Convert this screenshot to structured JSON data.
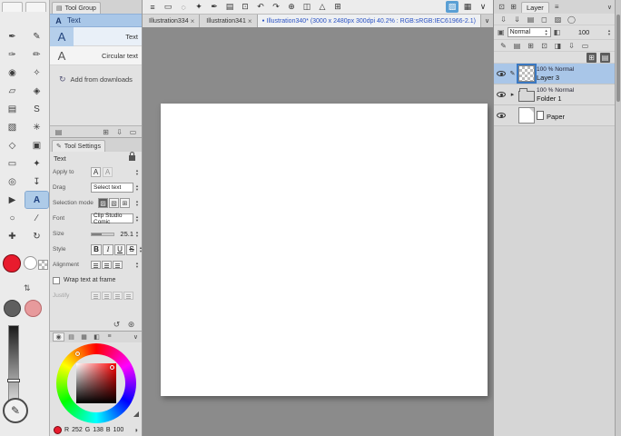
{
  "ui": {
    "spin_up": "▲",
    "spin_down": "▼",
    "chevron": "∨"
  },
  "colors": {
    "accent_blue": "#5a9fd4",
    "selection_blue": "#a9c6e8",
    "active_tab_text": "#2a52c4",
    "main_color_red": "#e81b2d"
  },
  "top_toolbar": {
    "icons": [
      {
        "glyph": "≡",
        "n": "main-menu-icon"
      },
      {
        "glyph": "▭",
        "n": "rect-select-icon"
      },
      {
        "glyph": "◌",
        "n": "lasso-select-icon"
      },
      {
        "glyph": "✦",
        "n": "auto-select-icon"
      },
      {
        "glyph": "✒",
        "n": "pen-box-icon"
      },
      {
        "glyph": "▤",
        "n": "fill-box-icon"
      },
      {
        "glyph": "⊡",
        "n": "canvas-settings-icon"
      },
      {
        "glyph": "↶",
        "n": "undo-icon"
      },
      {
        "glyph": "↷",
        "n": "redo-icon"
      },
      {
        "glyph": "⊕",
        "n": "add-icon"
      },
      {
        "glyph": "◫",
        "n": "panel-layout-icon"
      },
      {
        "glyph": "△",
        "n": "ruler-icon"
      },
      {
        "glyph": "⊞",
        "n": "grid-icon"
      }
    ],
    "right_icons": [
      {
        "glyph": "▨",
        "n": "workspace-active-icon",
        "blue": true
      },
      {
        "glyph": "▦",
        "n": "workspace-icon"
      },
      {
        "glyph": "∨",
        "n": "toolbar-overflow-chevron"
      }
    ]
  },
  "tab_bar": {
    "tabs": [
      {
        "label": "Illustration334",
        "close": "×"
      },
      {
        "label": "Illustration341",
        "close": "×"
      },
      {
        "label": "Illustration340* (3000 x 2480px 300dpi 40.2% : RGB:sRGB:IEC61966-2.1)",
        "dot": "●",
        "active": true
      }
    ]
  },
  "tool_strip": {
    "tools": [
      {
        "glyph": "✒",
        "n": "pen-tool"
      },
      {
        "glyph": "✎",
        "n": "pencil-tool"
      },
      {
        "glyph": "✑",
        "n": "brush-tool"
      },
      {
        "glyph": "✏",
        "n": "marker-tool"
      },
      {
        "glyph": "◉",
        "n": "airbrush-tool"
      },
      {
        "glyph": "✧",
        "n": "decoration-tool"
      },
      {
        "glyph": "▱",
        "n": "eraser-tool"
      },
      {
        "glyph": "◈",
        "n": "blend-tool"
      },
      {
        "glyph": "▤",
        "n": "fill-tool"
      },
      {
        "glyph": "S",
        "n": "s-brush-tool"
      },
      {
        "glyph": "▧",
        "n": "gradient-tool"
      },
      {
        "glyph": "✳",
        "n": "effect-tool"
      },
      {
        "glyph": "◇",
        "n": "figure-tool"
      },
      {
        "glyph": "▣",
        "n": "frame-border-tool"
      },
      {
        "glyph": "▭",
        "n": "selection-tool"
      },
      {
        "glyph": "✦",
        "n": "auto-select-tool"
      },
      {
        "glyph": "◎",
        "n": "zoom-tool"
      },
      {
        "glyph": "↧",
        "n": "eyedropper-tool"
      },
      {
        "glyph": "▶",
        "n": "operation-tool"
      },
      {
        "glyph": "A",
        "n": "text-tool",
        "selected": true
      },
      {
        "glyph": "○",
        "n": "balloon-tool"
      },
      {
        "glyph": "∕",
        "n": "line-tool"
      },
      {
        "glyph": "✚",
        "n": "move-tool"
      },
      {
        "glyph": "↻",
        "n": "rotate-tool"
      }
    ],
    "swap_icon": "⇅",
    "quick_glyph": "✎"
  },
  "tool_group": {
    "header": "Tool Group",
    "header_icon": "▤",
    "group_icon": "A",
    "group_label": "Text",
    "subtools": [
      {
        "glyph": "A",
        "label": "Text",
        "selected": true
      },
      {
        "glyph": "A",
        "label": "Circular text"
      }
    ],
    "download_icon": "↻",
    "add_from_downloads": "Add from downloads",
    "footer_icons": [
      {
        "glyph": "▤",
        "n": "subtool-view-icon"
      },
      {
        "glyph": "⊞",
        "n": "create-subtool-icon"
      },
      {
        "glyph": "⇩",
        "n": "import-subtool-icon"
      },
      {
        "glyph": "▭",
        "n": "delete-subtool-icon"
      }
    ]
  },
  "tool_settings": {
    "header": "Tool Settings",
    "header_icon": "✎",
    "tool_name": "Text",
    "apply_to_label": "Apply to",
    "apply_icons": [
      {
        "glyph": "A",
        "n": "apply-new-text-icon"
      },
      {
        "glyph": "A",
        "n": "apply-selected-text-icon",
        "grayed": true
      }
    ],
    "drag_label": "Drag",
    "drag_value": "Select text",
    "selection_mode_label": "Selection mode",
    "selection_mode_icons": [
      {
        "glyph": "▨",
        "n": "selection-new-icon",
        "dark": true
      },
      {
        "glyph": "▧",
        "n": "selection-add-icon"
      },
      {
        "glyph": "⊞",
        "n": "selection-remove-icon"
      }
    ],
    "font_label": "Font",
    "font_value": "Clip Studio Comic",
    "size_label": "Size",
    "size_value": "25.1",
    "style_label": "Style",
    "style_buttons": [
      {
        "glyph": "B",
        "n": "bold-button"
      },
      {
        "glyph": "I",
        "n": "italic-button"
      },
      {
        "glyph": "U",
        "n": "underline-button"
      },
      {
        "glyph": "S",
        "n": "strikeout-button"
      }
    ],
    "alignment_label": "Alignment",
    "alignment_icons": [
      {
        "n": "align-left-icon"
      },
      {
        "n": "align-center-icon"
      },
      {
        "n": "align-right-icon"
      }
    ],
    "wrap_label": "Wrap text at frame",
    "justify_label": "Justify",
    "justify_icons": [
      {
        "n": "justify-left-icon",
        "grayed": true
      },
      {
        "n": "justify-center-icon",
        "grayed": true
      },
      {
        "n": "justify-right-icon",
        "grayed": true
      },
      {
        "n": "justify-even-icon",
        "grayed": true
      }
    ],
    "footer_icons": [
      {
        "glyph": "↺",
        "n": "restore-defaults-icon"
      },
      {
        "glyph": "⊛",
        "n": "tool-property-settings-icon"
      }
    ]
  },
  "color_panel": {
    "tab_icons": [
      {
        "glyph": "◉",
        "n": "color-wheel-tab",
        "selected": true
      },
      {
        "glyph": "▤",
        "n": "color-slider-tab"
      },
      {
        "glyph": "▦",
        "n": "color-set-tab"
      },
      {
        "glyph": "◧",
        "n": "color-mixer-tab"
      },
      {
        "glyph": "≡",
        "n": "color-history-tab"
      }
    ],
    "rgb": {
      "r_label": "R",
      "r_value": "252",
      "g_label": "G",
      "g_value": "138",
      "b_label": "B",
      "b_value": "100"
    },
    "grip": "◢",
    "side_icon": "◑"
  },
  "layer_panel": {
    "tab_label": "Layer",
    "tab_icons_left": [
      {
        "glyph": "⊡",
        "n": "palette-dock-icon"
      },
      {
        "glyph": "⊞",
        "n": "palette-grid-icon"
      }
    ],
    "tab_icons_right": [
      {
        "glyph": "≡",
        "n": "layer-menu-icon"
      }
    ],
    "cmd_row1": [
      {
        "glyph": "⇩",
        "n": "transfer-down-icon"
      },
      {
        "glyph": "⇓",
        "n": "merge-down-icon"
      },
      {
        "glyph": "▤",
        "n": "layer-color-icon"
      },
      {
        "glyph": "◻",
        "n": "lock-layer-icon"
      },
      {
        "glyph": "▨",
        "n": "lock-transparent-icon"
      },
      {
        "glyph": "◯",
        "n": "enable-mask-icon"
      }
    ],
    "blend_icon": "▣",
    "blend_value": "Normal",
    "opacity_icon": "◧",
    "opacity_value": "100",
    "cmd_row2": [
      {
        "glyph": "✎",
        "n": "draw-mode-icon"
      },
      {
        "glyph": "▤",
        "n": "new-raster-layer-icon"
      },
      {
        "glyph": "⊞",
        "n": "new-vector-layer-icon"
      },
      {
        "glyph": "⊡",
        "n": "new-folder-icon"
      },
      {
        "glyph": "◨",
        "n": "layer-mask-icon"
      },
      {
        "glyph": "⇩",
        "n": "transfer-to-layer-icon"
      },
      {
        "glyph": "▭",
        "n": "delete-layer-icon"
      }
    ],
    "cmd_row3": [
      {
        "glyph": "⊞",
        "n": "list-view-icon",
        "dark": true
      },
      {
        "glyph": "▤",
        "n": "thumbnail-view-icon",
        "dark": true
      }
    ],
    "layers": [
      {
        "info": "100 % Normal",
        "name": "Layer 3",
        "mark": "✎",
        "kind": "raster",
        "selected": true
      },
      {
        "info": "100 % Normal",
        "name": "Folder 1",
        "mark": "▸",
        "kind": "folder"
      },
      {
        "info": "",
        "name": "Paper",
        "mark": "",
        "kind": "paper"
      }
    ]
  }
}
